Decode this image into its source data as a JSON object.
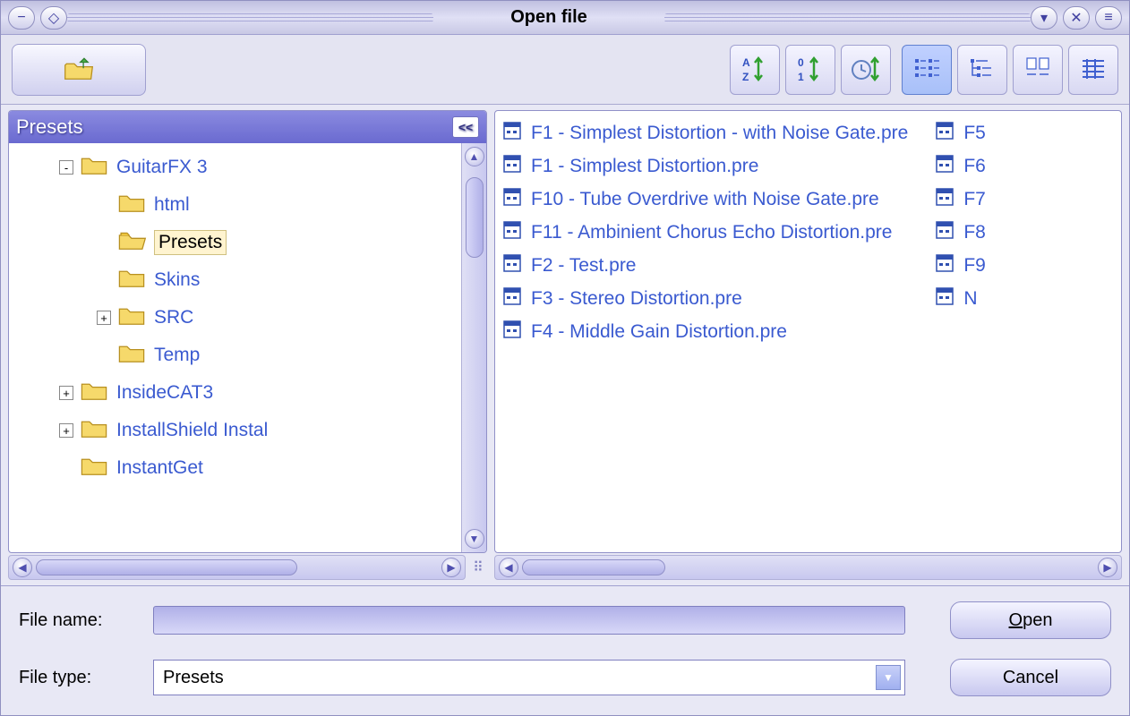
{
  "window": {
    "title": "Open file"
  },
  "toolbar": {
    "up_tooltip": "Up",
    "sort_alpha": "A-Z",
    "sort_num": "0-1",
    "sort_date": "Time",
    "view_small": "Small",
    "view_tree": "Tree",
    "view_list": "List",
    "view_detail": "Detail"
  },
  "tree": {
    "header": "Presets",
    "collapse": "<<",
    "nodes": [
      {
        "indent": 1,
        "expander": "-",
        "label": "GuitarFX 3",
        "selected": false,
        "open": false
      },
      {
        "indent": 2,
        "expander": "",
        "label": "html",
        "selected": false,
        "open": false
      },
      {
        "indent": 2,
        "expander": "",
        "label": "Presets",
        "selected": true,
        "open": true
      },
      {
        "indent": 2,
        "expander": "",
        "label": "Skins",
        "selected": false,
        "open": false
      },
      {
        "indent": 2,
        "expander": "+",
        "label": "SRC",
        "selected": false,
        "open": false
      },
      {
        "indent": 2,
        "expander": "",
        "label": "Temp",
        "selected": false,
        "open": false
      },
      {
        "indent": 1,
        "expander": "+",
        "label": "InsideCAT3",
        "selected": false,
        "open": false
      },
      {
        "indent": 1,
        "expander": "+",
        "label": "InstallShield Instal",
        "selected": false,
        "open": false
      },
      {
        "indent": 1,
        "expander": "",
        "label": "InstantGet",
        "selected": false,
        "open": false
      }
    ]
  },
  "files": {
    "col1": [
      "F1 - Simplest Distortion - with Noise Gate.pre",
      "F1 - Simplest Distortion.pre",
      "F10 - Tube Overdrive with Noise Gate.pre",
      "F11 - Ambinient Chorus Echo Distortion.pre",
      "F2 - Test.pre",
      "F3 - Stereo Distortion.pre",
      "F4 - Middle Gain Distortion.pre"
    ],
    "col2": [
      "F5",
      "F6",
      "F7",
      "F8",
      "F9",
      "N"
    ]
  },
  "form": {
    "filename_label": "File name:",
    "filename_value": "",
    "filetype_label": "File type:",
    "filetype_value": "Presets",
    "open_label": "Open",
    "cancel_label": "Cancel"
  }
}
